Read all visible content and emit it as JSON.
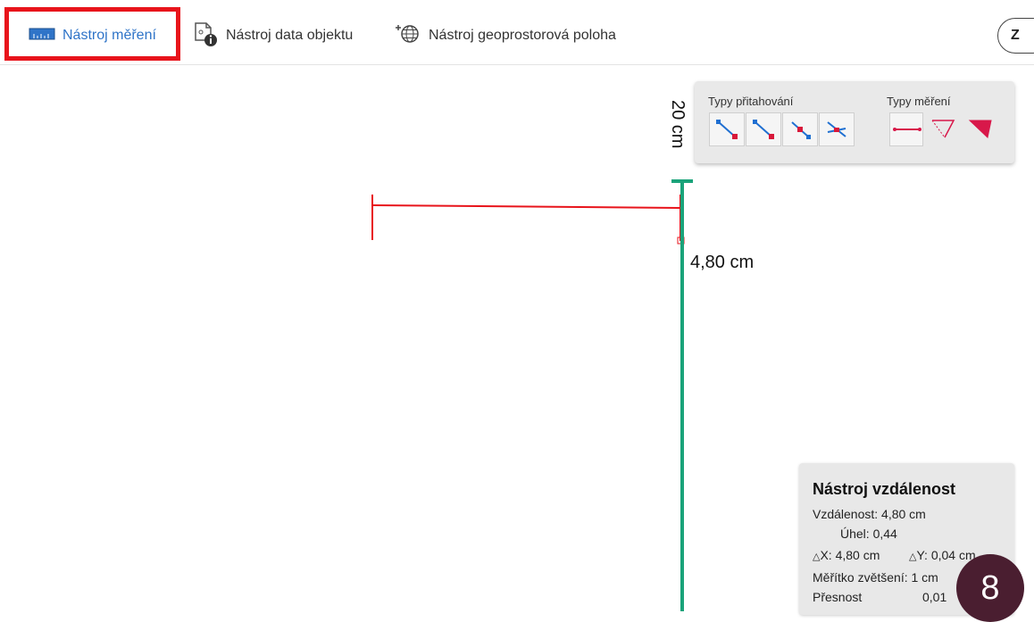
{
  "toolbar": {
    "measure_label": "Nástroj měření",
    "object_data_label": "Nástroj data objektu",
    "geo_label": "Nástroj geoprostorová poloha",
    "z_button_label": "Z"
  },
  "canvas": {
    "vertical_label": "20 cm",
    "distance_label": "4,80 cm",
    "colors": {
      "horizontal_line": "#e8141b",
      "vertical_line": "#1aa37a"
    }
  },
  "measure_panel": {
    "snap_title": "Typy přitahování",
    "measure_title": "Typy měření",
    "snap_icons": [
      "snap-endpoint-icon",
      "snap-midpoint-icon",
      "snap-point-icon",
      "snap-intersection-icon"
    ],
    "measure_icons": [
      "measure-distance-icon",
      "measure-angle-icon",
      "measure-area-icon"
    ]
  },
  "info_panel": {
    "title": "Nástroj vzdálenost",
    "distance": "Vzdálenost: 4,80 cm",
    "angle": "Úhel: 0,44",
    "dx": "X: 4,80 cm",
    "dy": "Y: 0,04 cm",
    "scale": "Měřítko zvětšení: 1 cm",
    "precision_label": "Přesnost",
    "precision_value": "0,01"
  },
  "badge": {
    "number": "8"
  }
}
